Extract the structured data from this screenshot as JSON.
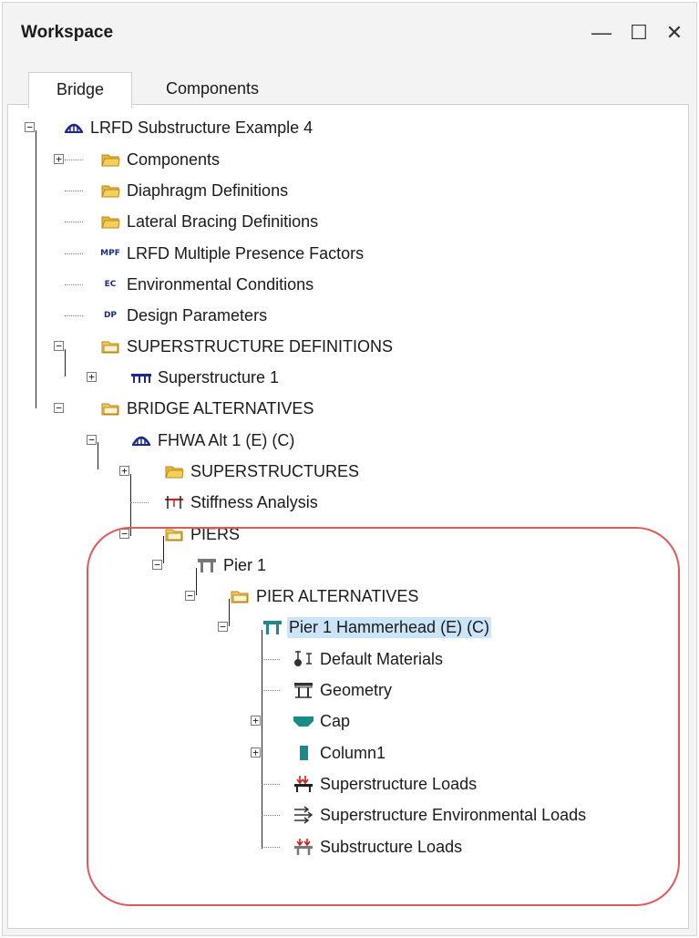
{
  "window": {
    "title": "Workspace",
    "controls": {
      "minimize": "—",
      "maximize": "☐",
      "close": "✕"
    }
  },
  "tabs": [
    {
      "label": "Bridge",
      "active": true
    },
    {
      "label": "Components",
      "active": false
    }
  ],
  "tree": {
    "root": {
      "label": "LRFD Substructure Example 4",
      "icon": "bridge-arch-icon"
    },
    "items": [
      {
        "label": "Components",
        "icon": "folder-icon"
      },
      {
        "label": "Diaphragm Definitions",
        "icon": "folder-icon"
      },
      {
        "label": "Lateral Bracing Definitions",
        "icon": "folder-icon"
      },
      {
        "label": "LRFD Multiple Presence Factors",
        "icon": "mpf-icon",
        "abbr": "MPF"
      },
      {
        "label": "Environmental Conditions",
        "icon": "ec-icon",
        "abbr": "EC"
      },
      {
        "label": "Design Parameters",
        "icon": "dp-icon",
        "abbr": "DP"
      },
      {
        "label": "SUPERSTRUCTURE DEFINITIONS",
        "icon": "folder-open-icon"
      },
      {
        "label": "Superstructure 1",
        "icon": "girder-icon"
      },
      {
        "label": "BRIDGE ALTERNATIVES",
        "icon": "folder-open-icon"
      },
      {
        "label": "FHWA Alt 1 (E)  (C)",
        "icon": "bridge-arch-icon"
      },
      {
        "label": "SUPERSTRUCTURES",
        "icon": "folder-icon"
      },
      {
        "label": "Stiffness Analysis",
        "icon": "stiffness-icon"
      },
      {
        "label": "PIERS",
        "icon": "folder-open-icon"
      },
      {
        "label": "Pier 1",
        "icon": "pier-icon"
      },
      {
        "label": "PIER ALTERNATIVES",
        "icon": "folder-open-icon"
      },
      {
        "label": "Pier 1 Hammerhead (E)  (C)",
        "icon": "pier-teal-icon",
        "selected": true
      },
      {
        "label": "Default Materials",
        "icon": "materials-icon"
      },
      {
        "label": "Geometry",
        "icon": "geometry-icon"
      },
      {
        "label": "Cap",
        "icon": "cap-icon"
      },
      {
        "label": "Column1",
        "icon": "column-icon"
      },
      {
        "label": "Superstructure Loads",
        "icon": "super-loads-icon"
      },
      {
        "label": "Superstructure Environmental Loads",
        "icon": "wind-loads-icon"
      },
      {
        "label": "Substructure Loads",
        "icon": "sub-loads-icon"
      }
    ]
  },
  "colors": {
    "accent_teal": "#1a8a8a",
    "folder": "#e8b637",
    "highlight_ring": "#e05a5a",
    "selection": "#cce4f7"
  }
}
